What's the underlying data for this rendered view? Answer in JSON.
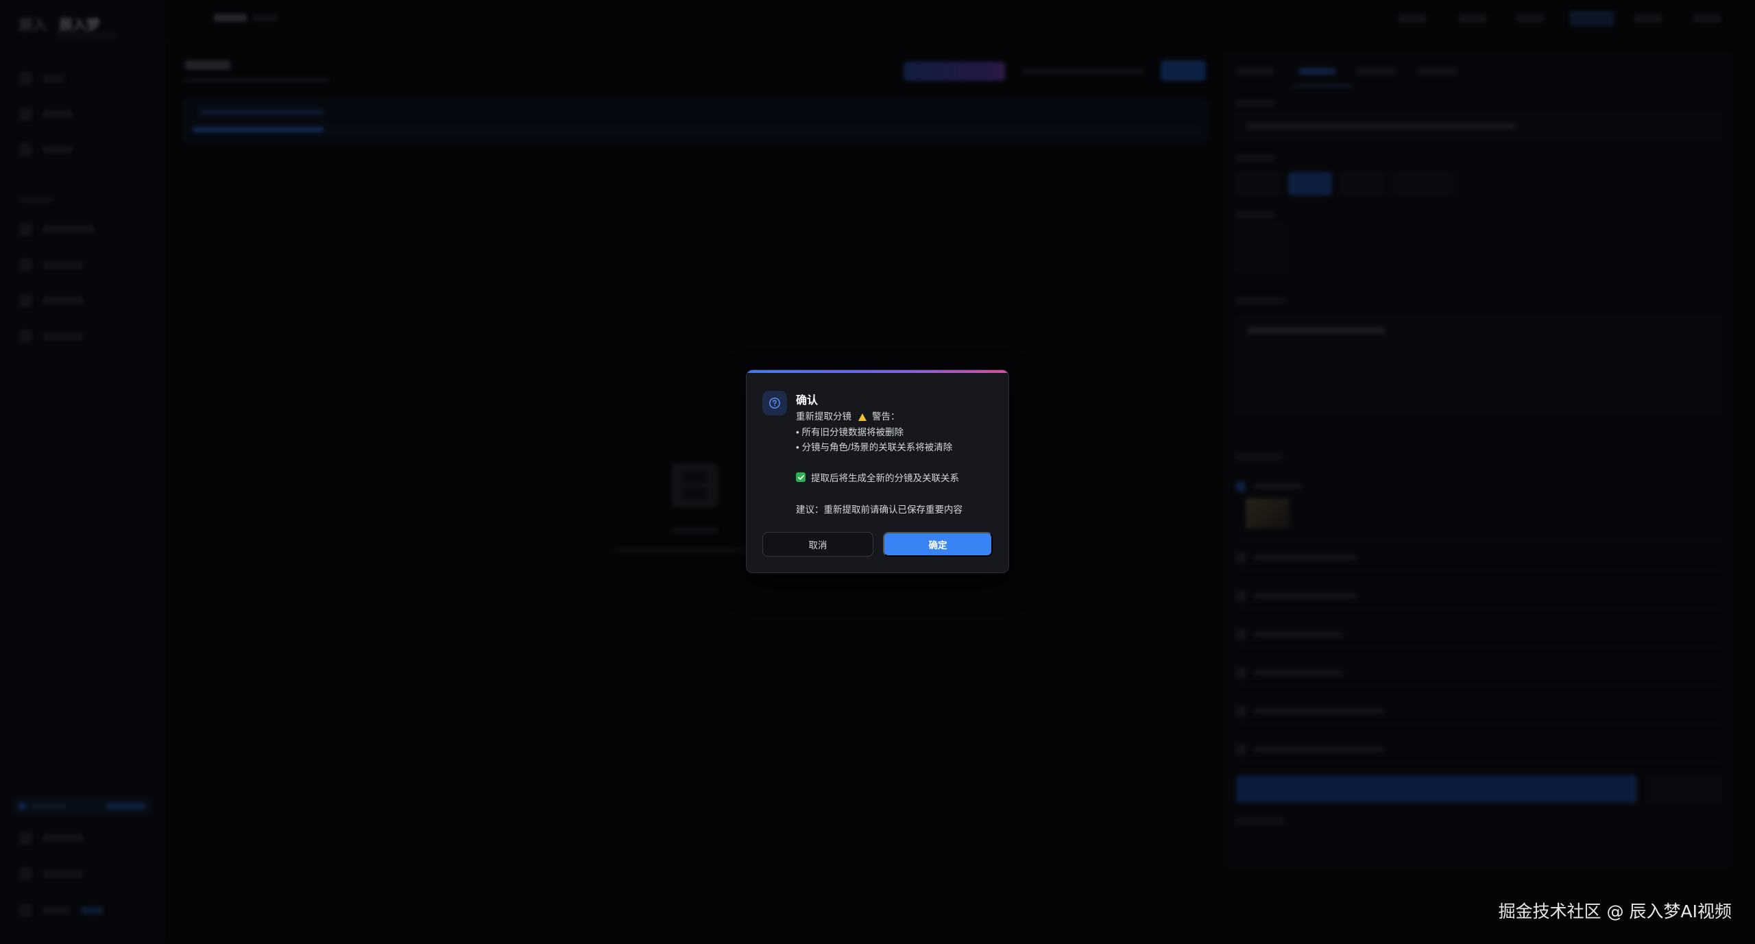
{
  "app": {
    "brand_logo": "辰入",
    "brand_name": "辰入梦"
  },
  "dialog": {
    "title": "确认",
    "heading_line": "重新提取分镜",
    "warning_label": "警告：",
    "bullets": [
      "• 所有旧分镜数据将被删除",
      "• 分镜与角色/场景的关联关系将被清除"
    ],
    "checkbox_label": "提取后将生成全新的分镜及关联关系",
    "checkbox_checked": true,
    "suggestion": "建议：重新提取前请确认已保存重要内容",
    "cancel_label": "取消",
    "confirm_label": "确定",
    "icon": "question-circle-icon",
    "accent_color": "#3a83f5"
  },
  "background": {
    "progress_fraction": 0.13
  },
  "watermark": "掘金技术社区 @ 辰入梦AI视频"
}
